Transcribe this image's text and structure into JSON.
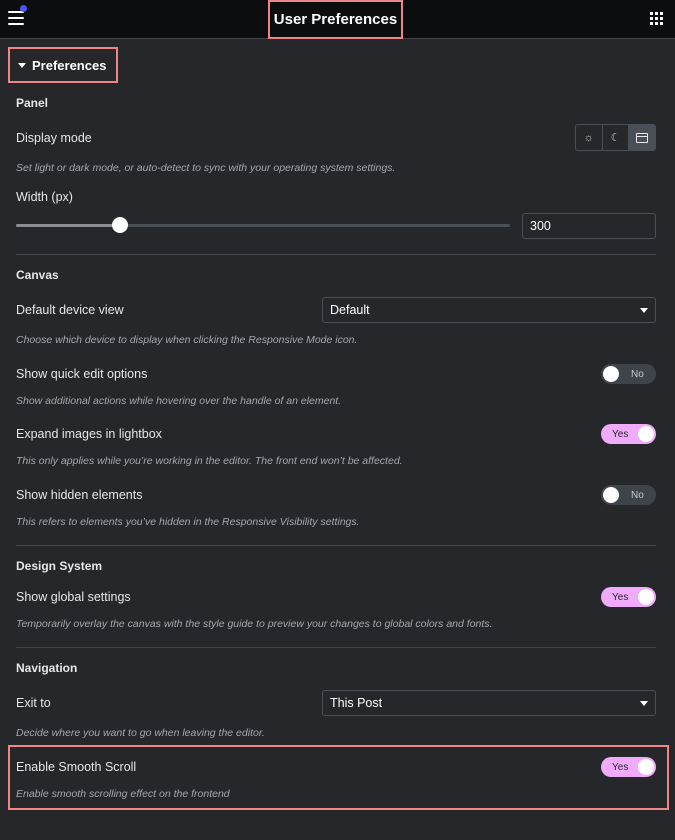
{
  "header": {
    "title": "User Preferences",
    "menu_icon": "hamburger-menu-icon",
    "apps_icon": "grid-apps-icon",
    "notification_dot_color": "#4b53ff"
  },
  "section": {
    "title": "Preferences",
    "expanded": true
  },
  "panel": {
    "heading": "Panel",
    "display_mode": {
      "label": "Display mode",
      "options": [
        "light",
        "dark",
        "auto"
      ],
      "selected": "auto",
      "light_glyph": "☼",
      "dark_glyph": "☾",
      "description": "Set light or dark mode, or auto-detect to sync with your operating system settings."
    },
    "width": {
      "label": "Width (px)",
      "value": "300",
      "slider_fraction": 0.21
    }
  },
  "canvas": {
    "heading": "Canvas",
    "device_view": {
      "label": "Default device view",
      "value": "Default",
      "description": "Choose which device to display when clicking the Responsive Mode icon."
    },
    "quick_edit": {
      "label": "Show quick edit options",
      "state": "No",
      "description": "Show additional actions while hovering over the handle of an element."
    },
    "lightbox": {
      "label": "Expand images in lightbox",
      "state": "Yes",
      "description": "This only applies while you’re working in the editor. The front end won’t be affected."
    },
    "hidden_elements": {
      "label": "Show hidden elements",
      "state": "No",
      "description": "This refers to elements you’ve hidden in the Responsive Visibility settings."
    }
  },
  "design_system": {
    "heading": "Design System",
    "global_settings": {
      "label": "Show global settings",
      "state": "Yes",
      "description": "Temporarily overlay the canvas with the style guide to preview your changes to global colors and fonts."
    }
  },
  "navigation": {
    "heading": "Navigation",
    "exit_to": {
      "label": "Exit to",
      "value": "This Post",
      "description": "Decide where you want to go when leaving the editor."
    },
    "smooth_scroll": {
      "label": "Enable Smooth Scroll",
      "state": "Yes",
      "description": "Enable smooth scrolling effect on the frontend"
    }
  },
  "colors": {
    "highlight": "#f08585",
    "toggle_on": "#f0abfc",
    "background": "#26272b"
  }
}
